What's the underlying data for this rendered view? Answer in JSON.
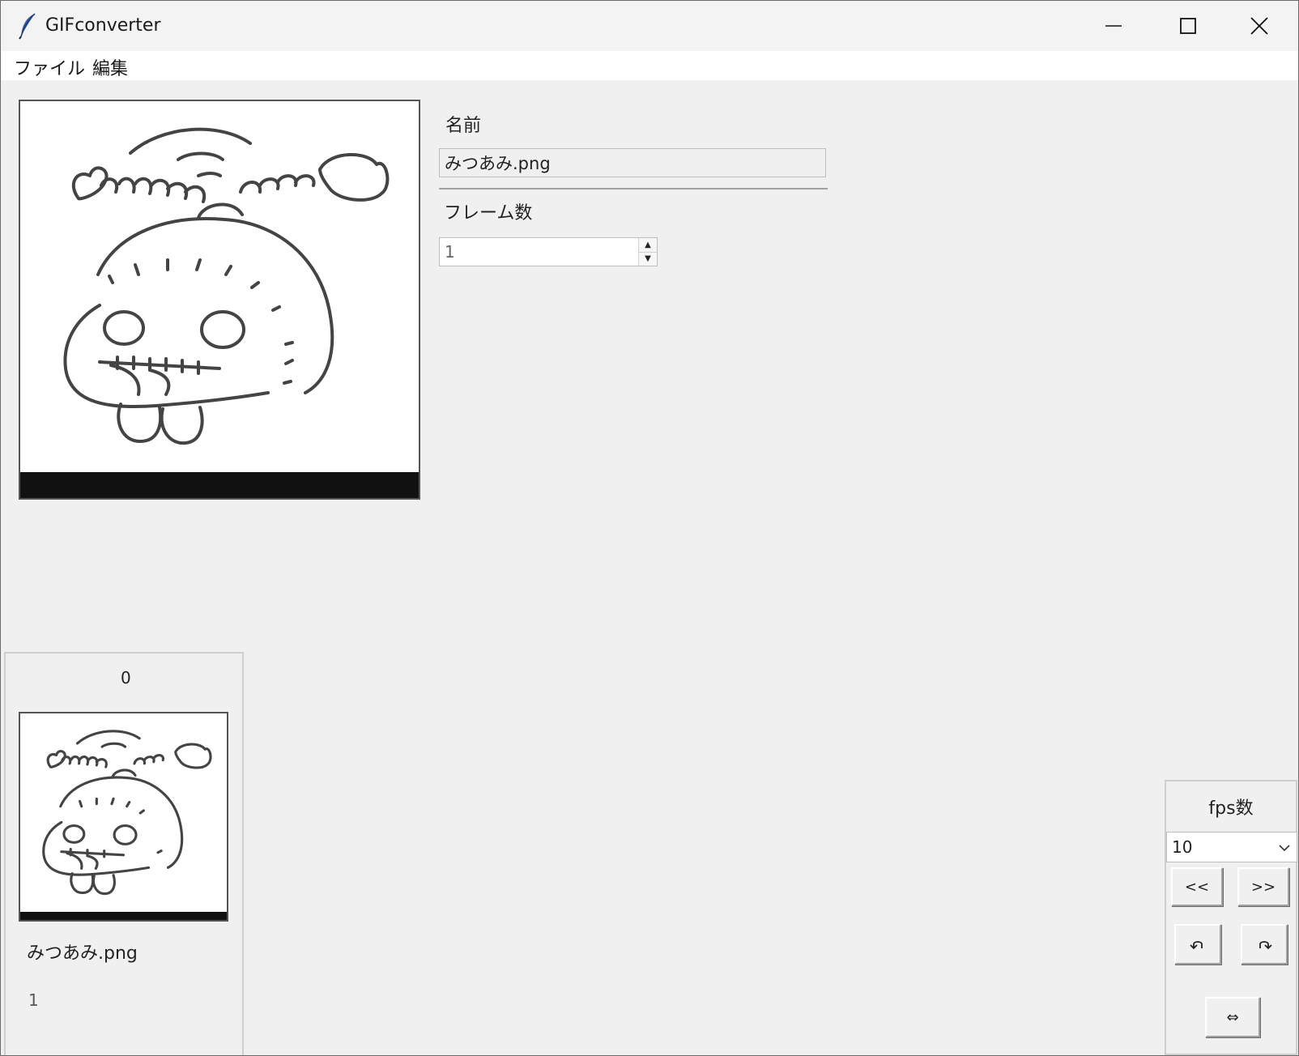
{
  "window": {
    "title": "GIFconverter",
    "app_icon": "feather-icon",
    "controls": [
      "minimize-icon",
      "maximize-icon",
      "close-icon"
    ]
  },
  "menubar": {
    "items": [
      {
        "label": "ファイル"
      },
      {
        "label": "編集"
      }
    ]
  },
  "editor": {
    "name_label": "名前",
    "name_value": "みつあみ.png",
    "frames_label": "フレーム数",
    "frames_value": "1"
  },
  "frame_list": {
    "items": [
      {
        "index": "0",
        "filename": "みつあみ.png",
        "frames": "1"
      }
    ]
  },
  "controls": {
    "fps_label": "fps数",
    "fps_value": "10",
    "prev_label": "<<",
    "next_label": ">>",
    "rotate_left_icon": "rotate-left-icon",
    "rotate_right_icon": "rotate-right-icon",
    "flip_label": "⇔"
  }
}
